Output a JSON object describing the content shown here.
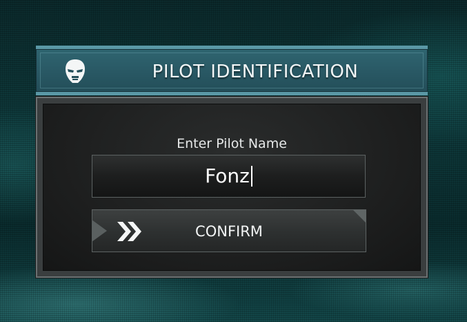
{
  "header": {
    "title": "PILOT IDENTIFICATION",
    "icon": "pilot-mask-icon"
  },
  "dialog": {
    "prompt": "Enter Pilot Name",
    "name_input_value": "Fonz",
    "confirm_label": "CONFIRM",
    "confirm_icon": "double-chevron-right-icon"
  },
  "colors": {
    "header_bg": "#2a5a66",
    "header_border": "#5a98a6",
    "panel_bg": "#1c1d1d",
    "text": "#f2f6f7"
  }
}
